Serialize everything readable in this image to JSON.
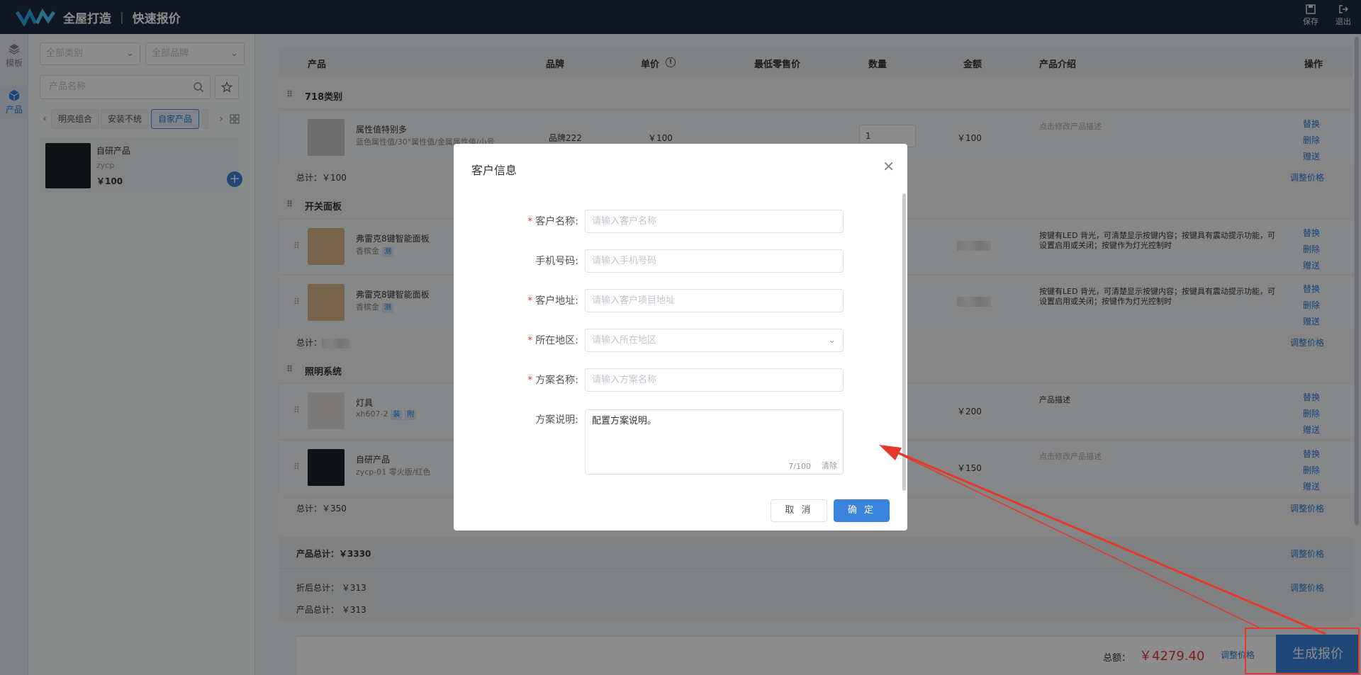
{
  "header": {
    "title": "全屋打造",
    "subtitle": "快速报价",
    "save": "保存",
    "exit": "退出"
  },
  "rail": {
    "template": "模板",
    "product": "产品"
  },
  "filters": {
    "category": "全部类别",
    "brand": "全部品牌",
    "search_placeholder": "产品名称"
  },
  "chips": [
    "明亮组合",
    "安装不统",
    "自家产品"
  ],
  "product_card": {
    "name": "自研产品",
    "code": "zycp",
    "price": "￥100"
  },
  "table": {
    "headers": {
      "product": "产品",
      "brand": "品牌",
      "price": "单价",
      "min_price": "最低零售价",
      "qty": "数量",
      "amount": "金额",
      "intro": "产品介绍",
      "ops": "操作"
    },
    "groups": [
      {
        "name": "718类别",
        "subtotal": "总计：￥100",
        "adjust": "调整价格"
      },
      {
        "name": "开关面板",
        "subtotal": "总计：",
        "adjust": "调整价格"
      },
      {
        "name": "照明系统",
        "subtotal": "总计：￥350",
        "adjust": "调整价格"
      }
    ],
    "rows": [
      {
        "name": "属性值特别多",
        "spec": "蓝色属性值/30°属性值/金属属性值/小号",
        "brand": "品牌222",
        "price": "￥100",
        "qty": "1",
        "amount": "￥100",
        "desc": "点击修改产品描述"
      },
      {
        "name": "弗雷克8键智能面板",
        "spec": "香槟金",
        "tag": "测",
        "desc": "按键有LED 背光，可清楚显示按键内容；按键具有震动提示功能，可设置启用或关闭；按键作为灯光控制时"
      },
      {
        "name": "弗雷克8键智能面板",
        "spec": "香槟金",
        "tag": "测",
        "desc": "按键有LED 背光，可清楚显示按键内容；按键具有震动提示功能，可设置启用或关闭；按键作为灯光控制时"
      },
      {
        "name": "灯具",
        "spec": "xh607-2",
        "tag": "装",
        "tag2": "附",
        "amount": "￥200",
        "desc": "产品描述"
      },
      {
        "name": "自研产品",
        "spec": "zycp-01 零火版/红色",
        "amount": "￥150",
        "desc": "点击修改产品描述"
      }
    ],
    "ops": [
      "替换",
      "删除",
      "赠送"
    ]
  },
  "summary": {
    "product_total": "产品总计：￥3330",
    "discount_total": "折后总计：  ￥313",
    "product_total2": "产品总计：  ￥313",
    "adjust": "调整价格"
  },
  "footer": {
    "total_label": "总额：",
    "total_value": "￥4279.40",
    "adjust": "调整价格",
    "generate": "生成报价"
  },
  "modal": {
    "title": "客户信息",
    "fields": {
      "name": {
        "label": "客户名称:",
        "placeholder": "请输入客户名称"
      },
      "phone": {
        "label": "手机号码:",
        "placeholder": "请输入手机号码"
      },
      "address": {
        "label": "客户地址:",
        "placeholder": "请输入客户项目地址"
      },
      "region": {
        "label": "所在地区:",
        "placeholder": "请输入所在地区"
      },
      "plan": {
        "label": "方案名称:",
        "placeholder": "请输入方案名称"
      },
      "desc": {
        "label": "方案说明:",
        "value": "配置方案说明。",
        "count": "7/100",
        "clear": "清除"
      }
    },
    "cancel": "取 消",
    "ok": "确 定"
  },
  "colors": {
    "accent": "#3a84dd",
    "danger": "#e33a2c",
    "header": "#1f2b3f"
  }
}
